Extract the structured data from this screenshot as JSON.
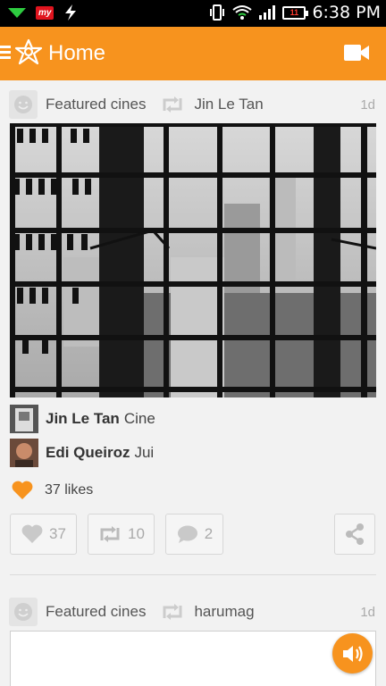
{
  "status_bar": {
    "carrier_badge": "my",
    "battery_level": "11",
    "time": "6:38 PM"
  },
  "app_bar": {
    "title": "Home",
    "accent_color": "#f7931e"
  },
  "post": {
    "feed_label": "Featured cines",
    "reposted_by": "Jin Le Tan",
    "time_ago": "1d",
    "comments": [
      {
        "author": "Jin Le Tan",
        "text": "Cine"
      },
      {
        "author": "Edi Queiroz",
        "text": "Jui"
      }
    ],
    "likes_text": "37 likes",
    "actions": {
      "like_count": "37",
      "repost_count": "10",
      "comment_count": "2"
    }
  },
  "next_post": {
    "feed_label": "Featured cines",
    "reposted_by": "harumag",
    "time_ago": "1d"
  }
}
